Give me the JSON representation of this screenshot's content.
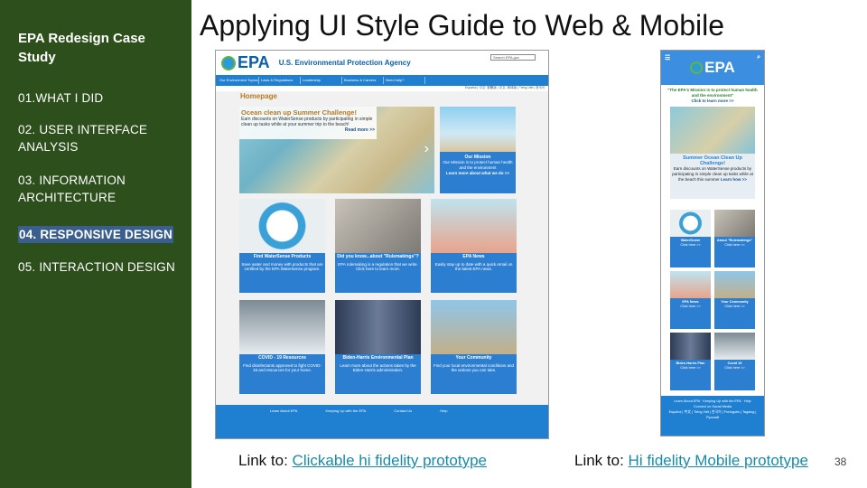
{
  "sidebar": {
    "title": "EPA Redesign Case Study",
    "items": [
      {
        "label": "01.WHAT I DID"
      },
      {
        "label": "02. USER INTERFACE ANALYSIS"
      },
      {
        "label": "03. INFORMATION ARCHITECTURE"
      },
      {
        "label": "04. RESPONSIVE DESIGN",
        "active": true
      },
      {
        "label": "05. INTERACTION DESIGN"
      }
    ]
  },
  "slide": {
    "title": "Applying UI Style Guide to Web & Mobile",
    "page_number": "38",
    "links": [
      {
        "prefix": "Link to: ",
        "text": "Clickable hi fidelity prototype"
      },
      {
        "prefix": "Link to: ",
        "text": "Hi fidelity Mobile prototype"
      }
    ]
  },
  "web_mock": {
    "logo": "EPA",
    "agency": "U.S. Environmental Protection Agency",
    "search_placeholder": "Search EPA.gov",
    "nav": [
      "Our Environment Topics",
      "Laws & Regulations",
      "Leadership",
      "Business & Careers",
      "Need help?"
    ],
    "lang_bar": "Español | 中文: 繁體版 | 中文: 简体版 | Tiếng Việt | 한국어",
    "home_title": "Homepage",
    "hero": {
      "headline": "Ocean clean up Summer Challenge!",
      "body": "Earn discounts on WaterSense products by participating in simple clean up tasks while at your summer trip to the beach!",
      "link": "Read more >>"
    },
    "mission": {
      "title": "Our Mission",
      "body": "Our Mission is to protect human health and the environment",
      "link": "Learn more about what we do >>"
    },
    "cards": [
      {
        "title": "Find WaterSense Products",
        "body": "Save water and money with products that are certified by the EPA WaterSense program."
      },
      {
        "title": "Did you know...about \"Rulemakings\"?",
        "body": "EPA rulemaking is a regulation that we write. Click here to learn more."
      },
      {
        "title": "EPA News",
        "body": "Easily stay up to date with a quick email on the latest EPA news."
      },
      {
        "title": "COVID - 19 Resources",
        "body": "Find disinfectants approved to fight COVID-19 and resources for your home."
      },
      {
        "title": "Biden-Harris Environmental Plan",
        "body": "Learn more about the actions taken by the Biden-Harris administration."
      },
      {
        "title": "Your Community",
        "body": "Find your local environmental conditions and the actions you can take."
      }
    ],
    "footer": [
      "Learn About EPA",
      "Keeping Up with the EPA",
      "Contact Us",
      "Help"
    ]
  },
  "mobile_mock": {
    "logo": "EPA",
    "mission": "\"The EPA's Mission is to protect human health and the environment\"",
    "mission_link": "Click to learn more >>",
    "summer_title": "Summer Ocean Clean Up Challenge!",
    "summer_body": "Earn discounts on WaterSense products by participating in simple clean up tasks while at the beach this summer",
    "summer_link": "Learn how >>",
    "cards": [
      {
        "title": "WaterSense",
        "link": "Click here >>"
      },
      {
        "title": "About \"Rulemakings\"",
        "link": "Click here >>"
      },
      {
        "title": "EPA News",
        "link": "Click here >>"
      },
      {
        "title": "Your Community",
        "link": "Click here >>"
      },
      {
        "title": "Biden-Harris Plan",
        "link": "Click here >>"
      },
      {
        "title": "Covid 19",
        "link": "Click here >>"
      }
    ],
    "footer": [
      "Learn About EPA",
      "Keeping Up with the EPA",
      "Help",
      "Connect on Social Media"
    ],
    "footer_lang": "Español | 中文 | Tiếng Việt | 한국어 | Português | Tagalog | Русский"
  },
  "colors": {
    "sidebar": "#2d4f1b",
    "active": "#3a5f8f",
    "epa_blue": "#1f7fd1",
    "link": "#1a8aa5"
  }
}
